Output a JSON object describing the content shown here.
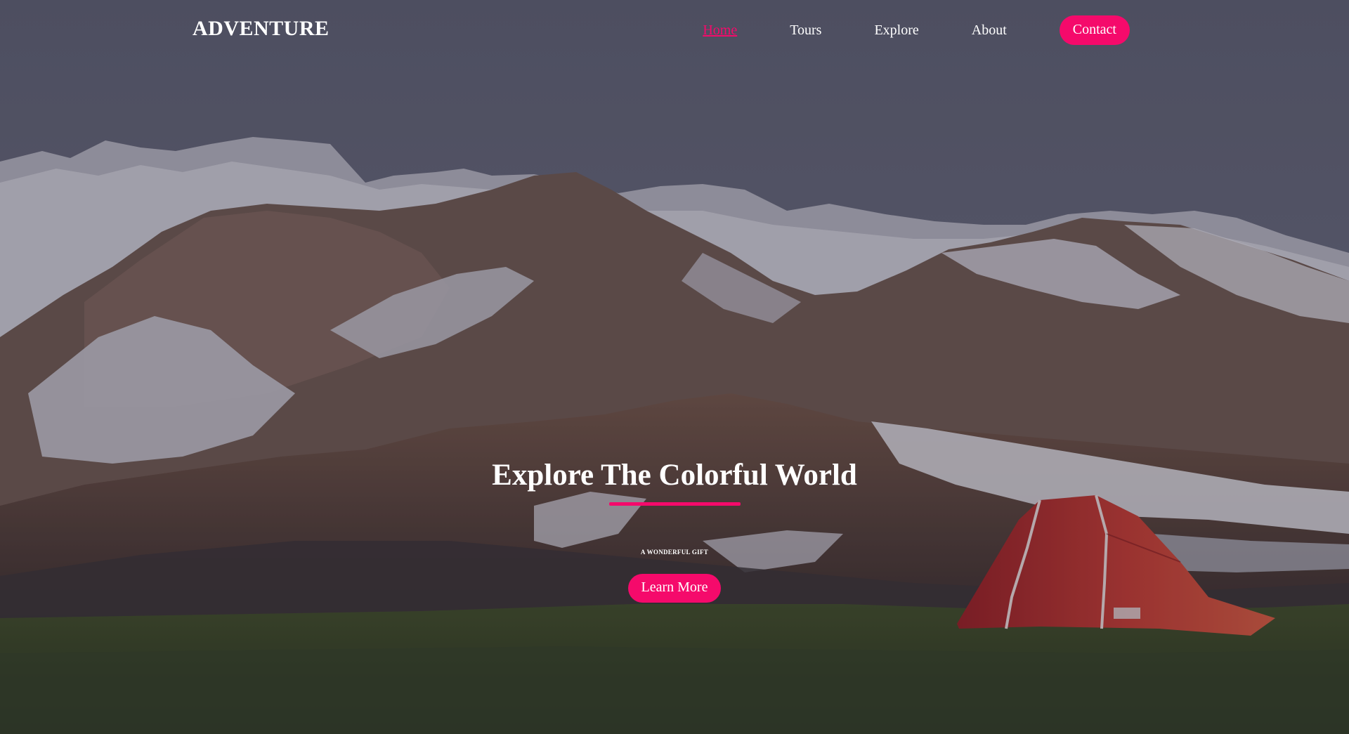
{
  "brand": {
    "name": "ADVENTURE"
  },
  "nav": {
    "items": [
      {
        "label": "Home",
        "active": true
      },
      {
        "label": "Tours",
        "active": false
      },
      {
        "label": "Explore",
        "active": false
      },
      {
        "label": "About",
        "active": false
      }
    ],
    "contact_label": "Contact"
  },
  "hero": {
    "title": "Explore The Colorful World",
    "subtitle": "A WONDERFUL GIFT",
    "button_label": "Learn More",
    "background_scene": "mountain-landscape-with-red-tent"
  },
  "colors": {
    "accent": "#f50a6b",
    "text": "#ffffff",
    "overlay": "#4a4b5c"
  }
}
